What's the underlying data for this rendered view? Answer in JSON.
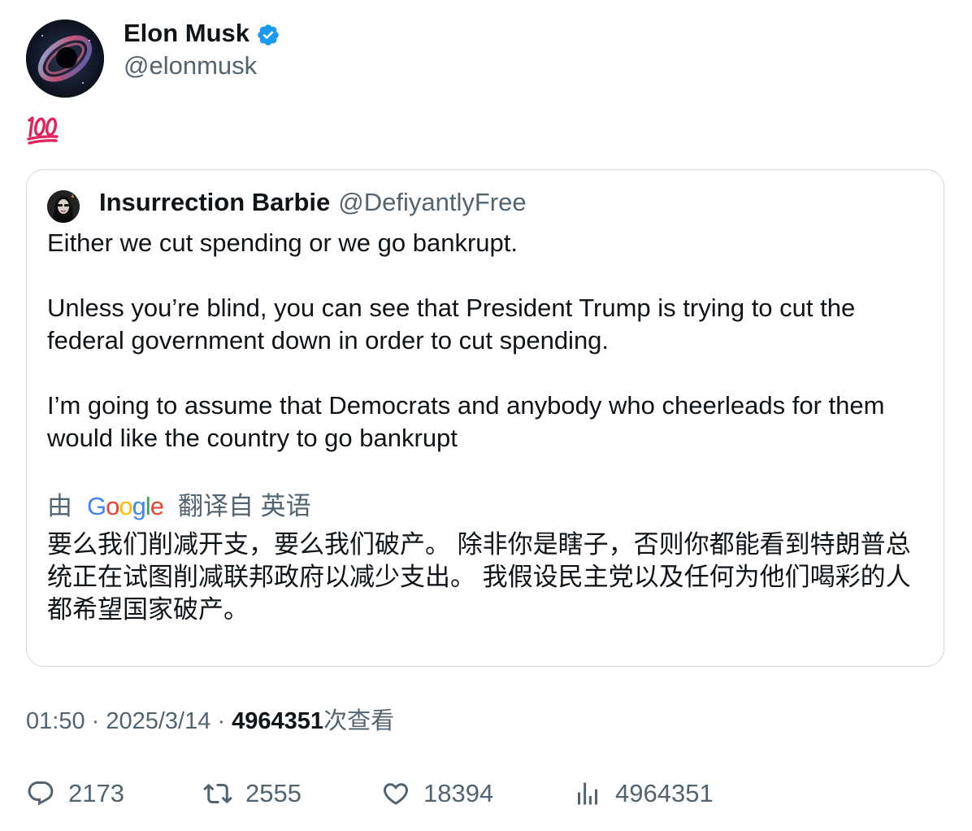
{
  "author": {
    "display_name": "Elon Musk",
    "handle": "@elonmusk",
    "verified": true,
    "avatar_icon": "black-hole-avatar"
  },
  "tweet": {
    "emoji_icon": "hundred-points-emoji"
  },
  "quoted_tweet": {
    "display_name": "Insurrection Barbie",
    "handle": "@DefiyantlyFree",
    "avatar_icon": "woman-portrait-avatar",
    "paragraphs": [
      "Either we cut spending or we go bankrupt.",
      "Unless you’re blind, you can see that President Trump is trying to cut the federal government down in order to cut spending.",
      "I’m going to assume that Democrats and anybody who cheerleads for them would like the country to go bankrupt"
    ],
    "translation": {
      "prefix": "由",
      "provider": "Google",
      "suffix": "翻译自 英语",
      "text": "要么我们削减开支，要么我们破产。 除非你是瞎子，否则你都能看到特朗普总统正在试图削减联邦政府以减少支出。 我假设民主党以及任何为他们喝彩的人都希望国家破产。"
    }
  },
  "meta": {
    "time": "01:50",
    "separator": "·",
    "date": "2025/3/14",
    "views_count": "4964351",
    "views_label": "次查看"
  },
  "actions": {
    "replies": "2173",
    "reposts": "2555",
    "likes": "18394",
    "views": "4964351"
  },
  "colors": {
    "verified": "#1d9bf0",
    "secondary_text": "#536471",
    "primary_text": "#0f1419",
    "border": "#cfd9de",
    "emoji_red": "#e0245e"
  }
}
